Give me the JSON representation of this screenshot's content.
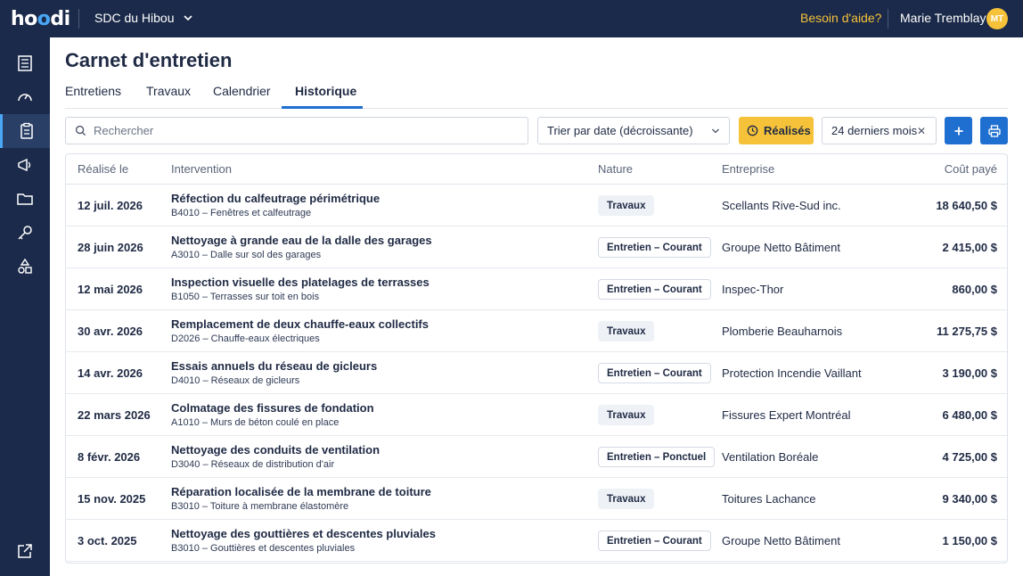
{
  "header": {
    "logo": "hoodi",
    "organization": "SDC du Hibou",
    "help_link": "Besoin d'aide?",
    "user_name": "Marie Tremblay",
    "user_initials": "MT"
  },
  "sidebar": {
    "items": [
      {
        "icon": "building-icon",
        "active": false
      },
      {
        "icon": "dashboard-gauge-icon",
        "active": false
      },
      {
        "icon": "clipboard-icon",
        "active": true
      },
      {
        "icon": "megaphone-icon",
        "active": false
      },
      {
        "icon": "folder-icon",
        "active": false
      },
      {
        "icon": "key-icon",
        "active": false
      },
      {
        "icon": "shapes-icon",
        "active": false
      }
    ],
    "bottom_icon": "external-link-icon"
  },
  "page": {
    "title": "Carnet d'entretien",
    "tabs": [
      {
        "label": "Entretiens",
        "active": false
      },
      {
        "label": "Travaux",
        "active": false
      },
      {
        "label": "Calendrier",
        "active": false
      },
      {
        "label": "Historique",
        "active": true
      }
    ]
  },
  "toolbar": {
    "search_placeholder": "Rechercher",
    "sort_value": "Trier par date (décroissante)",
    "filter_button": "Réalisés",
    "period_value": "24 derniers mois",
    "accent_color": "#1f6fd1",
    "filter_color": "#f5c23a"
  },
  "table": {
    "headers": {
      "date": "Réalisé le",
      "intervention": "Intervention",
      "nature": "Nature",
      "company": "Entreprise",
      "cost": "Coût payé"
    },
    "rows": [
      {
        "date": "12 juil. 2026",
        "title": "Réfection du calfeutrage périmétrique",
        "sub": "B4010 – Fenêtres et calfeutrage",
        "nature": "Travaux",
        "company": "Scellants Rive-Sud inc.",
        "cost": "18 640,50 $"
      },
      {
        "date": "28 juin 2026",
        "title": "Nettoyage à grande eau de la dalle des garages",
        "sub": "A3010 – Dalle sur sol des garages",
        "nature": "Entretien – Courant",
        "company": "Groupe Netto Bâtiment",
        "cost": "2 415,00 $"
      },
      {
        "date": "12 mai 2026",
        "title": "Inspection visuelle des platelages de terrasses",
        "sub": "B1050 – Terrasses sur toit en bois",
        "nature": "Entretien – Courant",
        "company": "Inspec-Thor",
        "cost": "860,00 $"
      },
      {
        "date": "30 avr. 2026",
        "title": "Remplacement de deux chauffe-eaux collectifs",
        "sub": "D2026 – Chauffe-eaux électriques",
        "nature": "Travaux",
        "company": "Plomberie Beauharnois",
        "cost": "11 275,75 $"
      },
      {
        "date": "14 avr. 2026",
        "title": "Essais annuels du réseau de gicleurs",
        "sub": "D4010 – Réseaux de gicleurs",
        "nature": "Entretien – Courant",
        "company": "Protection Incendie Vaillant",
        "cost": "3 190,00 $"
      },
      {
        "date": "22 mars 2026",
        "title": "Colmatage des fissures de fondation",
        "sub": "A1010 – Murs de béton coulé en place",
        "nature": "Travaux",
        "company": "Fissures Expert Montréal",
        "cost": "6 480,00 $"
      },
      {
        "date": "8 févr. 2026",
        "title": "Nettoyage des conduits de ventilation",
        "sub": "D3040 – Réseaux de distribution d'air",
        "nature": "Entretien – Ponctuel",
        "company": "Ventilation Boréale",
        "cost": "4 725,00 $"
      },
      {
        "date": "15 nov. 2025",
        "title": "Réparation localisée de la membrane de toiture",
        "sub": "B3010 – Toiture à membrane élastomère",
        "nature": "Travaux",
        "company": "Toitures Lachance",
        "cost": "9 340,00 $"
      },
      {
        "date": "3 oct. 2025",
        "title": "Nettoyage des gouttières et descentes pluviales",
        "sub": "B3010 – Gouttières et descentes pluviales",
        "nature": "Entretien – Courant",
        "company": "Groupe Netto Bâtiment",
        "cost": "1 150,00 $"
      }
    ]
  }
}
